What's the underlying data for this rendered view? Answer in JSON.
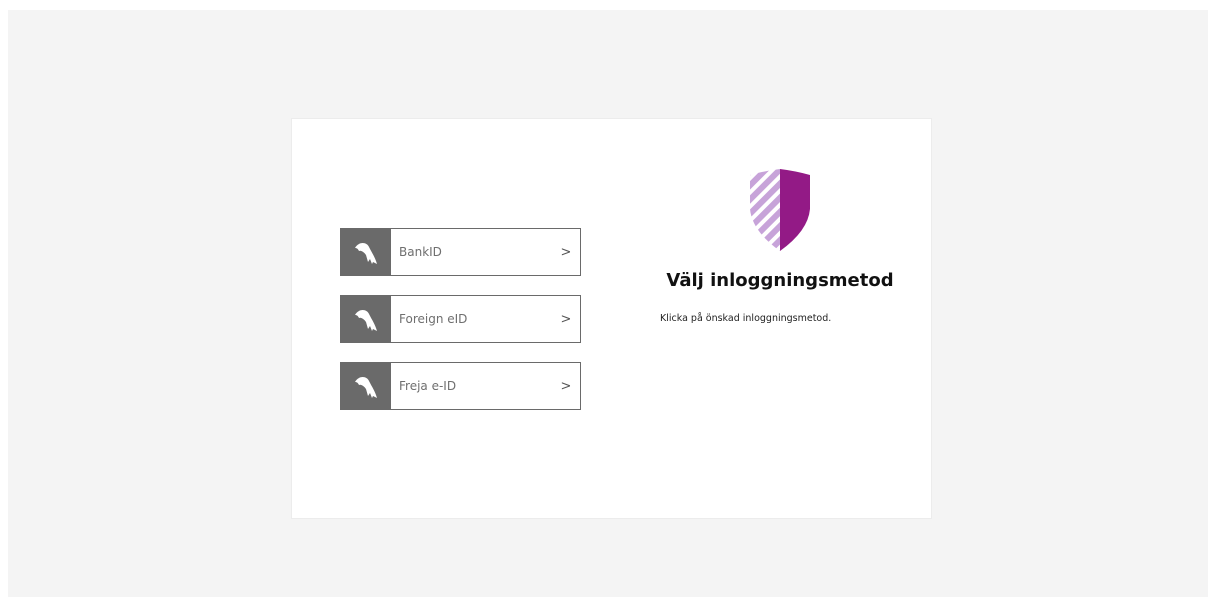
{
  "login": {
    "heading": "Välj inloggningsmetod",
    "instruction": "Klicka på önskad inloggningsmetod.",
    "methods": [
      {
        "label": "BankID",
        "icon": "bird-icon"
      },
      {
        "label": "Foreign eID",
        "icon": "bird-icon"
      },
      {
        "label": "Freja e-ID",
        "icon": "bird-icon"
      }
    ],
    "chevron": ">",
    "colors": {
      "page_bg": "#f4f4f4",
      "icon_box": "#6a6a6a",
      "shield_light": "#c7a3d9",
      "shield_dark": "#931a86"
    }
  }
}
